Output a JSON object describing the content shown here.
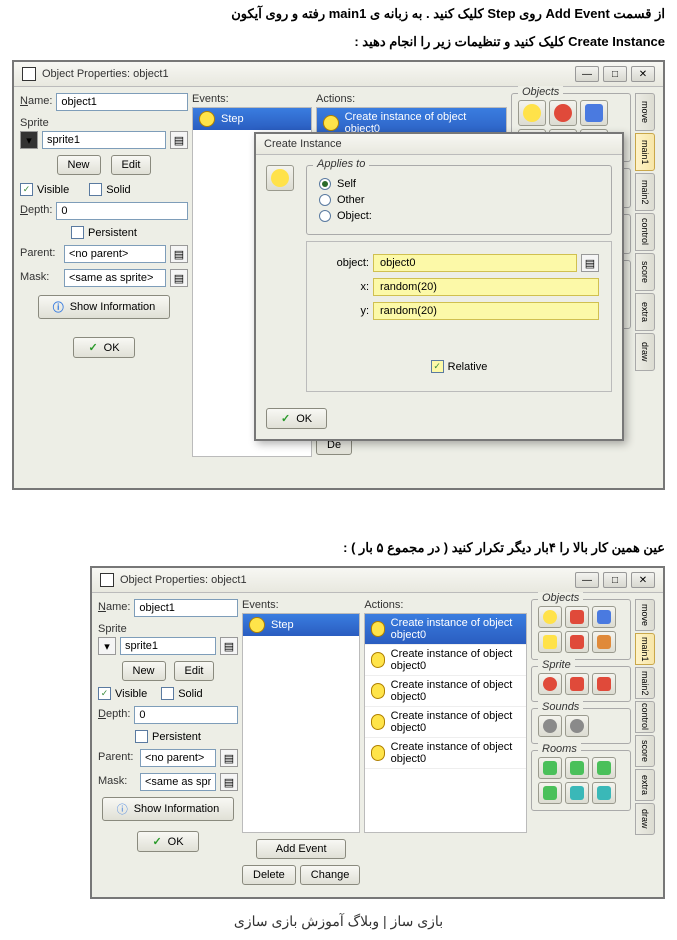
{
  "instr1": "از قسمت Add Event روی Step کلیک کنید . به زبانه ی main1 رفته و روی آیکون",
  "instr2": "Create Instance کلیک کنید و تنظیمات زیر را انجام دهید :",
  "instr3": "عین همین کار بالا را ۴بار دیگر تکرار کنید ( در مجموع ۵ بار )  :",
  "footer": "بازی ساز | وبلاگ آموزش بازی سازی",
  "win1": {
    "title": "Object Properties: object1",
    "name_lbl": "Name:",
    "name_val": "object1",
    "sprite_lbl": "Sprite",
    "sprite_val": "sprite1",
    "new": "New",
    "edit": "Edit",
    "visible": "Visible",
    "solid": "Solid",
    "depth_lbl": "Depth:",
    "depth_val": "0",
    "persistent": "Persistent",
    "parent_lbl": "Parent:",
    "parent_val": "<no parent>",
    "mask_lbl": "Mask:",
    "mask_val": "<same as sprite>",
    "showinfo": "Show Information",
    "ok": "OK",
    "events_lbl": "Events:",
    "actions_lbl": "Actions:",
    "event_step": "Step",
    "action1": "Create instance of object object0",
    "de": "De",
    "sections": {
      "objects": "Objects",
      "sprite": "Sprite",
      "sounds": "Sounds",
      "rooms": "Rooms"
    },
    "tabs": {
      "move": "move",
      "main1": "main1",
      "main2": "main2",
      "control": "control",
      "score": "score",
      "extra": "extra",
      "draw": "draw"
    }
  },
  "dlg": {
    "title": "Create Instance",
    "applies": "Applies to",
    "self": "Self",
    "other": "Other",
    "object": "Object:",
    "object_lbl": "object:",
    "object_val": "object0",
    "x_lbl": "x:",
    "x_val": "random(20)",
    "y_lbl": "y:",
    "y_val": "random(20)",
    "relative": "Relative",
    "ok": "OK"
  },
  "win2": {
    "title": "Object Properties: object1",
    "action": "Create instance of object object0",
    "addevent": "Add Event",
    "delete": "Delete",
    "change": "Change"
  },
  "icon_colors": {
    "yellow": "#ffe24a",
    "red": "#e04a3a",
    "blue": "#4a7ae0",
    "green": "#4ac05a",
    "orange": "#e08a3a",
    "gray": "#8a8a8a",
    "teal": "#3ab8b8",
    "purple": "#a05ad0"
  }
}
